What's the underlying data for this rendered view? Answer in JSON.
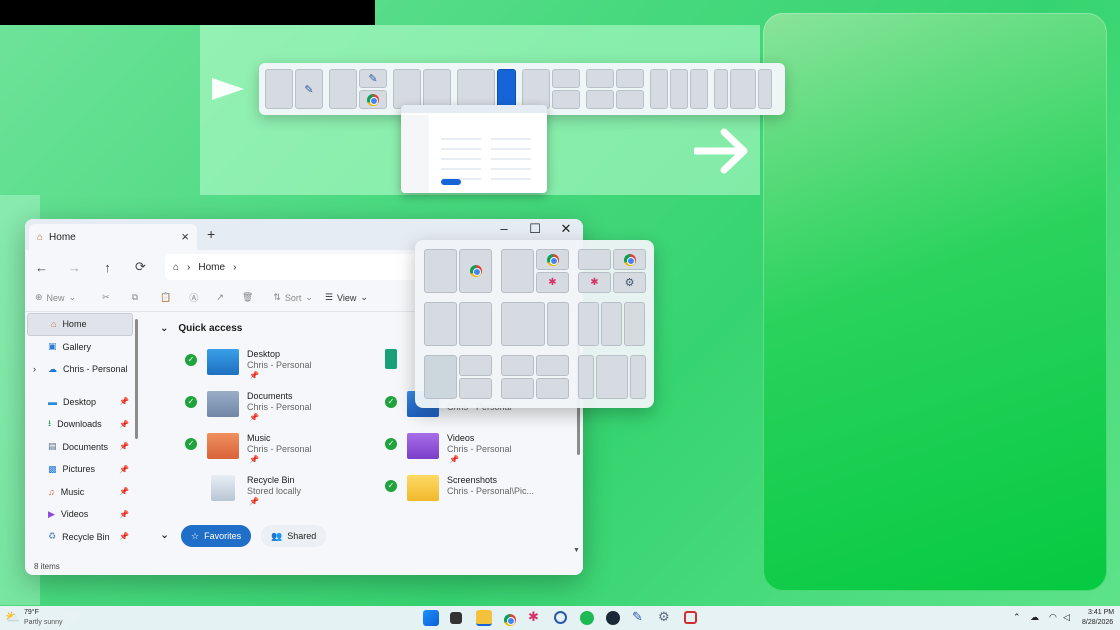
{
  "explorer": {
    "tab_title": "Home",
    "address": "Home",
    "commands": {
      "new": "New",
      "sort": "Sort",
      "view": "View"
    },
    "quick_access_title": "Quick access",
    "sidebar": [
      {
        "label": "Home"
      },
      {
        "label": "Gallery"
      },
      {
        "label": "Chris - Personal"
      },
      {
        "label": "Desktop"
      },
      {
        "label": "Downloads"
      },
      {
        "label": "Documents"
      },
      {
        "label": "Pictures"
      },
      {
        "label": "Music"
      },
      {
        "label": "Videos"
      },
      {
        "label": "Recycle Bin"
      }
    ],
    "files": [
      {
        "name": "Desktop",
        "sub": "Chris - Personal"
      },
      {
        "name": "Documents",
        "sub": "Chris - Personal"
      },
      {
        "name": "Music",
        "sub": "Chris - Personal"
      },
      {
        "name": "Recycle Bin",
        "sub": "Stored locally"
      },
      {
        "name": "",
        "sub": "Chris - Personal"
      },
      {
        "name": "Videos",
        "sub": "Chris - Personal"
      },
      {
        "name": "Screenshots",
        "sub": "Chris - Personal\\Pic..."
      }
    ],
    "favorites": "Favorites",
    "shared": "Shared",
    "status": "8 items"
  },
  "taskbar": {
    "weather_temp": "79°F",
    "weather_desc": "Partly sunny",
    "time": "3:41 PM",
    "date": "8/28/2026"
  },
  "colors": {
    "accent": "#1565d8",
    "check": "#1fa33c"
  }
}
